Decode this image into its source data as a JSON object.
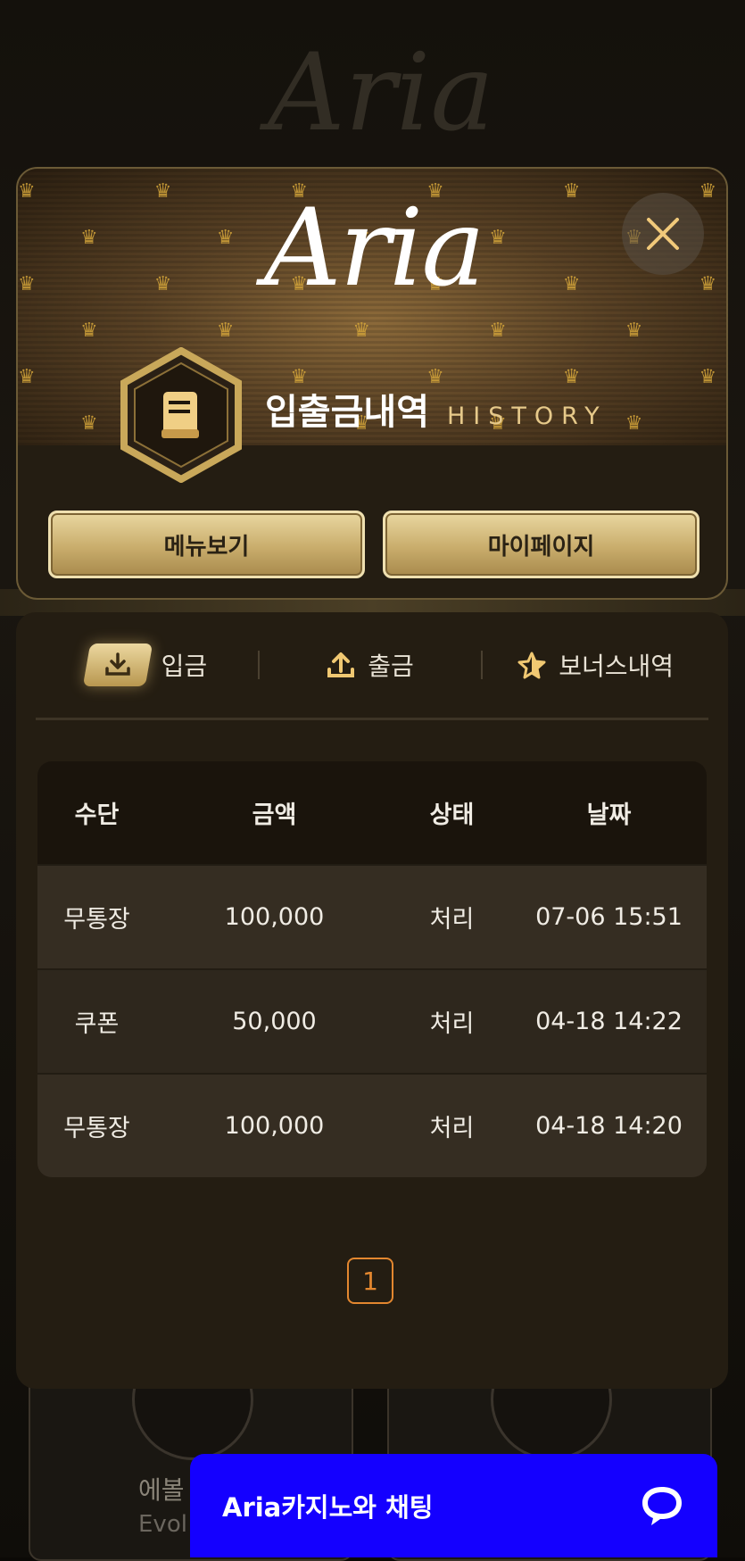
{
  "modal": {
    "logo": "Aria",
    "title_ko": "입출금내역",
    "title_en": "HISTORY",
    "buttons": {
      "menu": "메뉴보기",
      "mypage": "마이페이지"
    }
  },
  "tabs": [
    {
      "label": "입금",
      "icon": "download-icon",
      "active": true
    },
    {
      "label": "출금",
      "icon": "upload-icon",
      "active": false
    },
    {
      "label": "보너스내역",
      "icon": "star-icon",
      "active": false
    }
  ],
  "table": {
    "headers": [
      "수단",
      "금액",
      "상태",
      "날짜"
    ],
    "rows": [
      [
        "무통장",
        "100,000",
        "처리",
        "07-06 15:51"
      ],
      [
        "쿠폰",
        "50,000",
        "처리",
        "04-18 14:22"
      ],
      [
        "무통장",
        "100,000",
        "처리",
        "04-18 14:20"
      ]
    ]
  },
  "pagination": {
    "current": "1"
  },
  "chat": {
    "label": "Aria카지노와 채팅"
  },
  "background": {
    "logo": "Aria",
    "card_text": "에볼",
    "card_text2": "Evol"
  },
  "colors": {
    "accent_gold": "#e6c98a",
    "pager": "#e3872f",
    "chat": "#1400ff"
  }
}
